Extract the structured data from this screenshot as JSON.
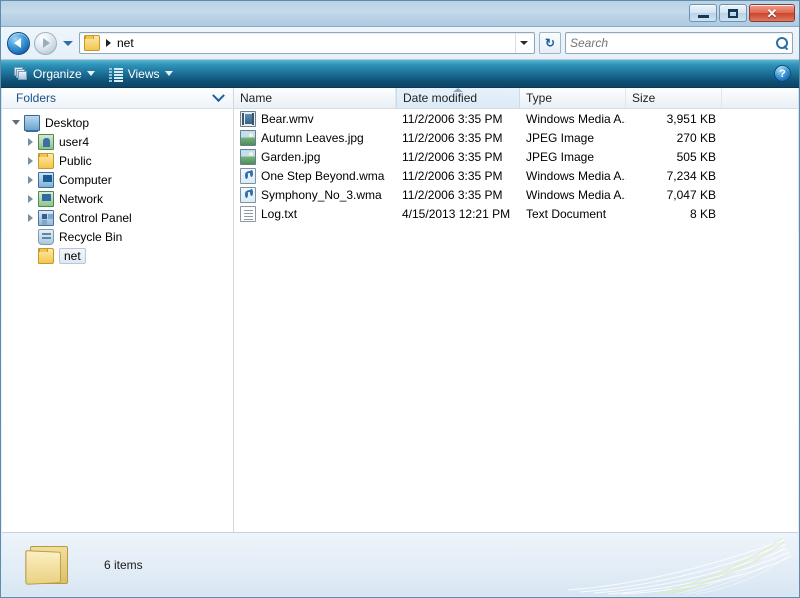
{
  "window": {
    "controls": {
      "minimize_label": "–",
      "minimize_name": "minimize-button",
      "maximize_label": "",
      "close_label": "✕"
    }
  },
  "address_bar": {
    "back_title": "Back",
    "forward_title": "Forward",
    "history_title": "Recent pages",
    "crumb_root_icon": "folder-icon",
    "crumb": "net",
    "dropdown_title": "Previous locations",
    "refresh_label": "↻",
    "refresh_title": "Refresh"
  },
  "search": {
    "placeholder": "Search",
    "value": "",
    "icon": "search-icon"
  },
  "toolbar": {
    "organize_label": "Organize",
    "views_label": "Views",
    "help_label": "?"
  },
  "folders_pane": {
    "header": "Folders",
    "items": [
      {
        "label": "Desktop",
        "icon": "desktop-icon",
        "indent": 0,
        "expander": "down",
        "selected": false
      },
      {
        "label": "user4",
        "icon": "user-folder-icon",
        "indent": 1,
        "expander": "right",
        "selected": false
      },
      {
        "label": "Public",
        "icon": "folder-icon",
        "indent": 1,
        "expander": "right",
        "selected": false
      },
      {
        "label": "Computer",
        "icon": "computer-icon",
        "indent": 1,
        "expander": "right",
        "selected": false
      },
      {
        "label": "Network",
        "icon": "network-icon",
        "indent": 1,
        "expander": "right",
        "selected": false
      },
      {
        "label": "Control Panel",
        "icon": "control-panel-icon",
        "indent": 1,
        "expander": "right",
        "selected": false
      },
      {
        "label": "Recycle Bin",
        "icon": "recycle-bin-icon",
        "indent": 1,
        "expander": "none",
        "selected": false
      },
      {
        "label": "net",
        "icon": "folder-icon",
        "indent": 1,
        "expander": "none",
        "selected": true
      }
    ]
  },
  "file_list": {
    "columns": [
      {
        "key": "name",
        "label": "Name",
        "sorted": false
      },
      {
        "key": "date",
        "label": "Date modified",
        "sorted": true,
        "direction": "ascending"
      },
      {
        "key": "type",
        "label": "Type",
        "sorted": false
      },
      {
        "key": "size",
        "label": "Size",
        "sorted": false
      }
    ],
    "rows": [
      {
        "name": "Bear.wmv",
        "date": "11/2/2006 3:35 PM",
        "type": "Windows Media A...",
        "size": "3,951 KB",
        "icon": "video-file-icon"
      },
      {
        "name": "Autumn Leaves.jpg",
        "date": "11/2/2006 3:35 PM",
        "type": "JPEG Image",
        "size": "270 KB",
        "icon": "image-file-icon"
      },
      {
        "name": "Garden.jpg",
        "date": "11/2/2006 3:35 PM",
        "type": "JPEG Image",
        "size": "505 KB",
        "icon": "image-file-icon"
      },
      {
        "name": "One Step Beyond.wma",
        "date": "11/2/2006 3:35 PM",
        "type": "Windows Media A...",
        "size": "7,234 KB",
        "icon": "audio-file-icon"
      },
      {
        "name": "Symphony_No_3.wma",
        "date": "11/2/2006 3:35 PM",
        "type": "Windows Media A...",
        "size": "7,047 KB",
        "icon": "audio-file-icon"
      },
      {
        "name": "Log.txt",
        "date": "4/15/2013 12:21 PM",
        "type": "Text Document",
        "size": "8 KB",
        "icon": "text-file-icon"
      }
    ]
  },
  "status_bar": {
    "item_count": "6 items",
    "folder_icon": "folder-icon"
  },
  "colors": {
    "accent": "#1b6d95",
    "title_bar": "#bcd4e7",
    "toolbar_dark": "#0d4367",
    "selection": "#dfe9f2",
    "close_button": "#c9442c"
  }
}
